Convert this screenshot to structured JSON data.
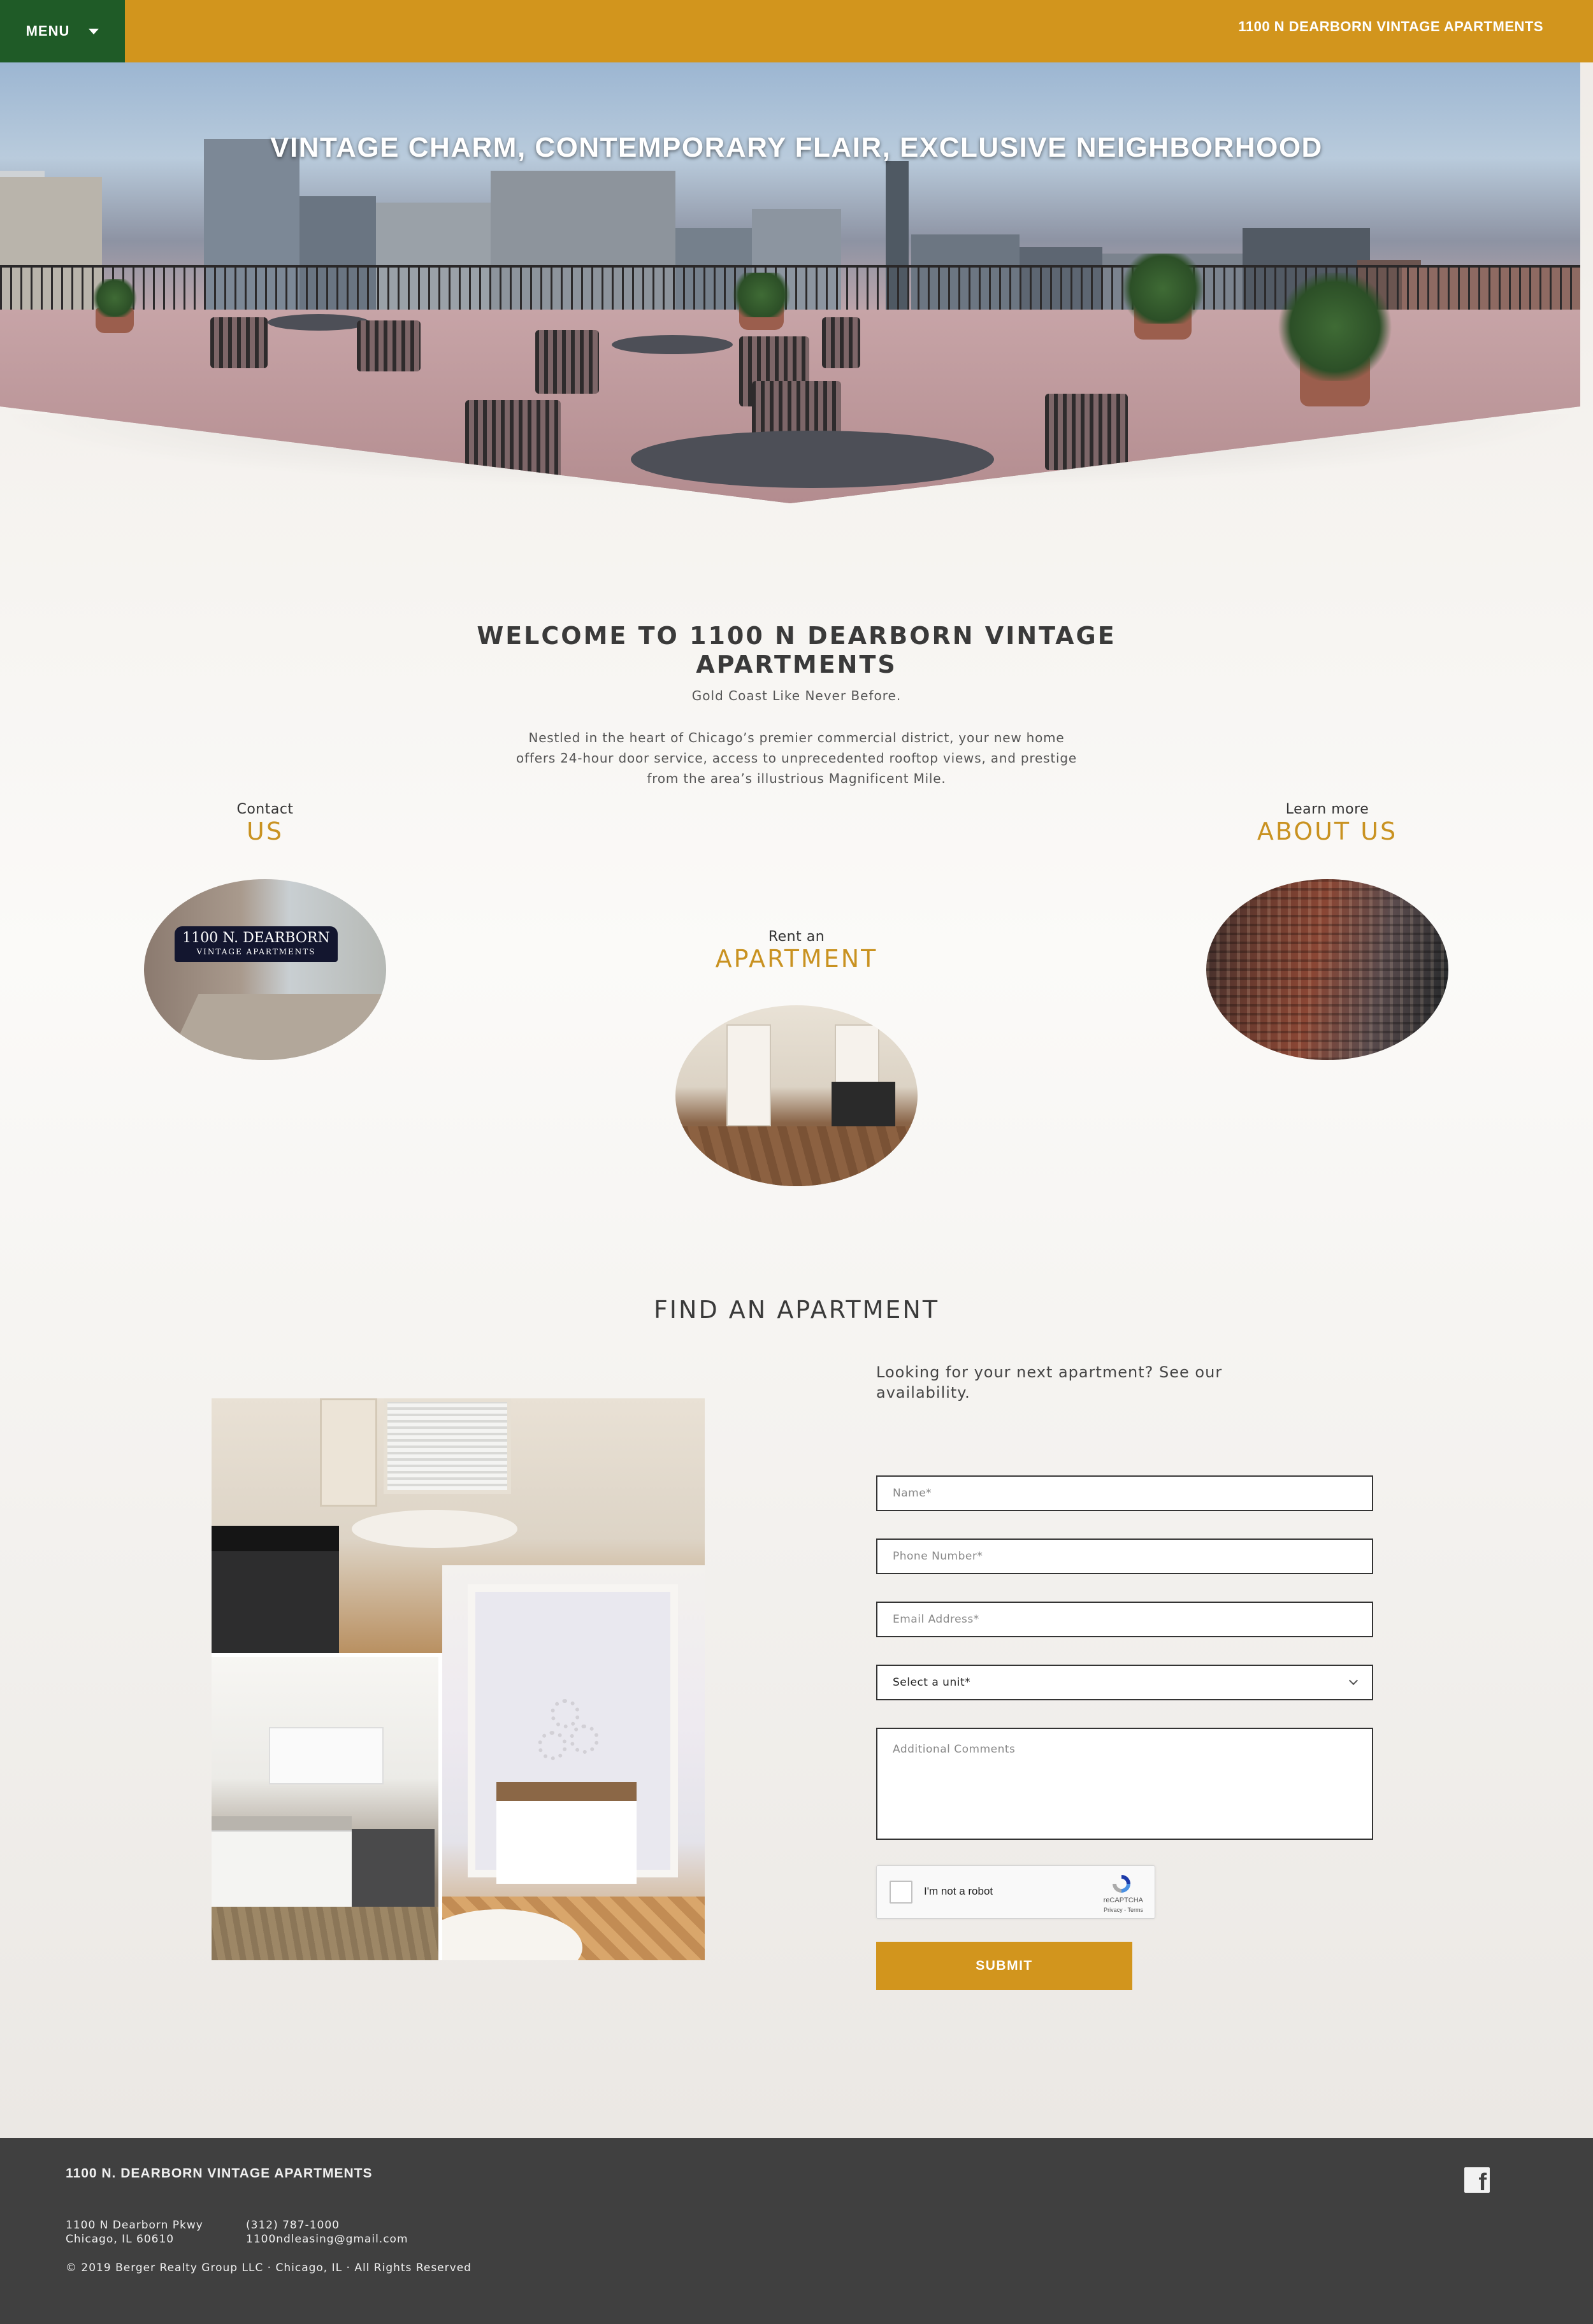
{
  "header": {
    "menu_label": "MENU",
    "site_title": "1100 N DEARBORN VINTAGE APARTMENTS"
  },
  "hero": {
    "headline": "VINTAGE CHARM, CONTEMPORARY FLAIR, EXCLUSIVE NEIGHBORHOOD"
  },
  "welcome": {
    "title_line1": "WELCOME TO 1100 N DEARBORN VINTAGE",
    "title_line2": "APARTMENTS",
    "tagline": "Gold Coast Like Never Before.",
    "intro": "Nestled in the heart of Chicago’s premier commercial district, your new home offers 24-hour door service, access to unprecedented rooftop views, and prestige from the area’s illustrious Magnificent Mile."
  },
  "features": {
    "contact": {
      "small": "Contact",
      "big": "US",
      "sign_line1": "1100 N. DEARBORN",
      "sign_line2": "VINTAGE APARTMENTS"
    },
    "apartment": {
      "small": "Rent an",
      "big": "APARTMENT"
    },
    "about": {
      "small": "Learn more",
      "big": "ABOUT US"
    }
  },
  "find": {
    "title": "FIND AN APARTMENT",
    "lead": "Looking for your next apartment? See our availability.",
    "name_placeholder": "Name*",
    "phone_placeholder": "Phone Number*",
    "email_placeholder": "Email Address*",
    "unit_selected": "Select a unit*",
    "comments_placeholder": "Additional Comments",
    "captcha_label": "I'm not a robot",
    "captcha_brand": "reCAPTCHA",
    "captcha_terms": "Privacy - Terms",
    "submit_label": "SUBMIT"
  },
  "footer": {
    "title": "1100 N. DEARBORN VINTAGE APARTMENTS",
    "address_line1": "1100 N Dearborn Pkwy",
    "address_line2": "Chicago, IL 60610",
    "phone": "(312) 787-1000",
    "email": "1100ndleasing@gmail.com",
    "copyright": "© 2019 Berger Realty Group LLC · Chicago, IL · All Rights Reserved",
    "social_icon": "facebook-icon"
  },
  "colors": {
    "accent_gold": "#d2951d",
    "menu_green": "#1f5b27",
    "footer_gray": "#404040",
    "heading_gold": "#c99221"
  }
}
